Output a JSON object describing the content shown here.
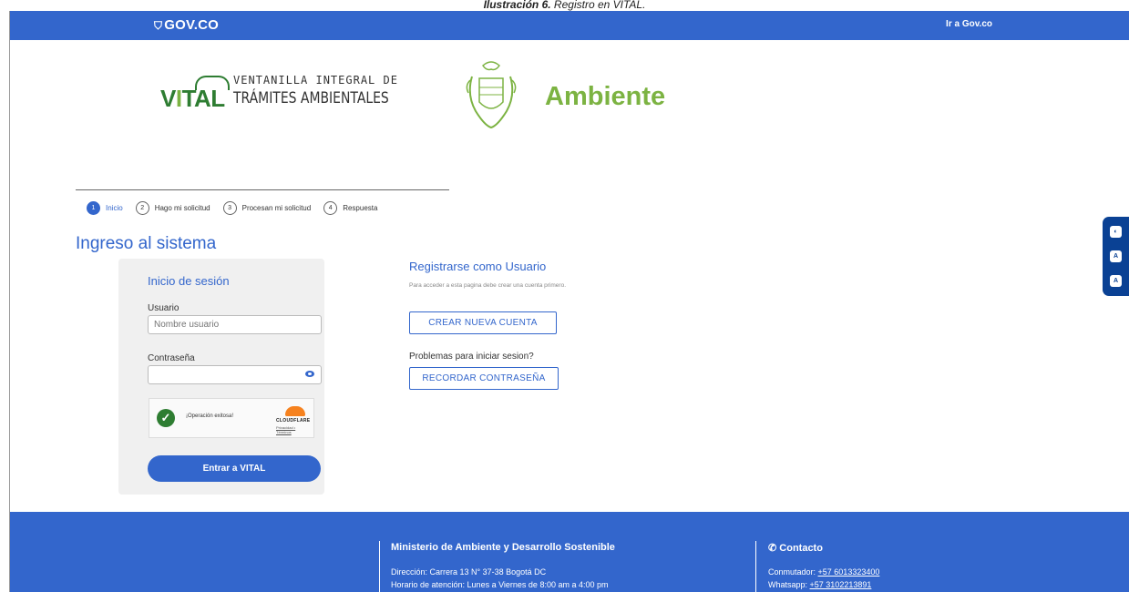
{
  "caption": {
    "bold": "Ilustración 6.",
    "rest": " Registro en VITAL."
  },
  "topbar": {
    "gov_logo": "GOV.CO",
    "gov_link": "Ir a Gov.co"
  },
  "logos": {
    "vital_word_v": "V",
    "vital_word_i": "I",
    "vital_word_rest": "TAL",
    "vital_line1": "VENTANILLA INTEGRAL DE",
    "vital_line2": "TRÁMITES AMBIENTALES",
    "ambiente": "Ambiente"
  },
  "steps": [
    {
      "num": "1",
      "label": "Inicio",
      "active": true
    },
    {
      "num": "2",
      "label": "Hago mi solicitud",
      "active": false
    },
    {
      "num": "3",
      "label": "Procesan mi solicitud",
      "active": false
    },
    {
      "num": "4",
      "label": "Respuesta",
      "active": false
    }
  ],
  "page_title": "Ingreso al sistema",
  "login": {
    "title": "Inicio de sesión",
    "user_label": "Usuario",
    "user_placeholder": "Nombre usuario",
    "user_value": "",
    "password_label": "Contraseña",
    "password_value": "",
    "captcha_status": "¡Operación exitosa!",
    "captcha_provider": "CLOUDFLARE",
    "captcha_links": "Privacidad • Términos",
    "submit": "Entrar a VITAL"
  },
  "register": {
    "title": "Registrarse como Usuario",
    "subtitle": "Para acceder a esta pagina debe crear una cuenta primero.",
    "create_button": "CREAR NUEVA CUENTA",
    "problems": "Problemas para iniciar sesion?",
    "recover_button": "RECORDAR CONTRASEÑA"
  },
  "side_toolbar": [
    "◐",
    "A",
    "A"
  ],
  "footer": {
    "ministry_title": "Ministerio de Ambiente y Desarrollo Sostenible",
    "address": "Dirección: Carrera 13 N° 37-38 Bogotá DC",
    "hours": "Horario de atención: Lunes a Viernes de 8:00 am a 4:00 pm",
    "contact_title": "Contacto",
    "phone_label": "Conmutador: ",
    "phone": "+57 6013323400",
    "whatsapp_label": "Whatsapp: ",
    "whatsapp": "+57 3102213891"
  },
  "colors": {
    "brand_blue": "#3366cc",
    "vital_green": "#2e7d32",
    "ambiente_green": "#7cb342",
    "toolbar_navy": "#0a4194"
  }
}
